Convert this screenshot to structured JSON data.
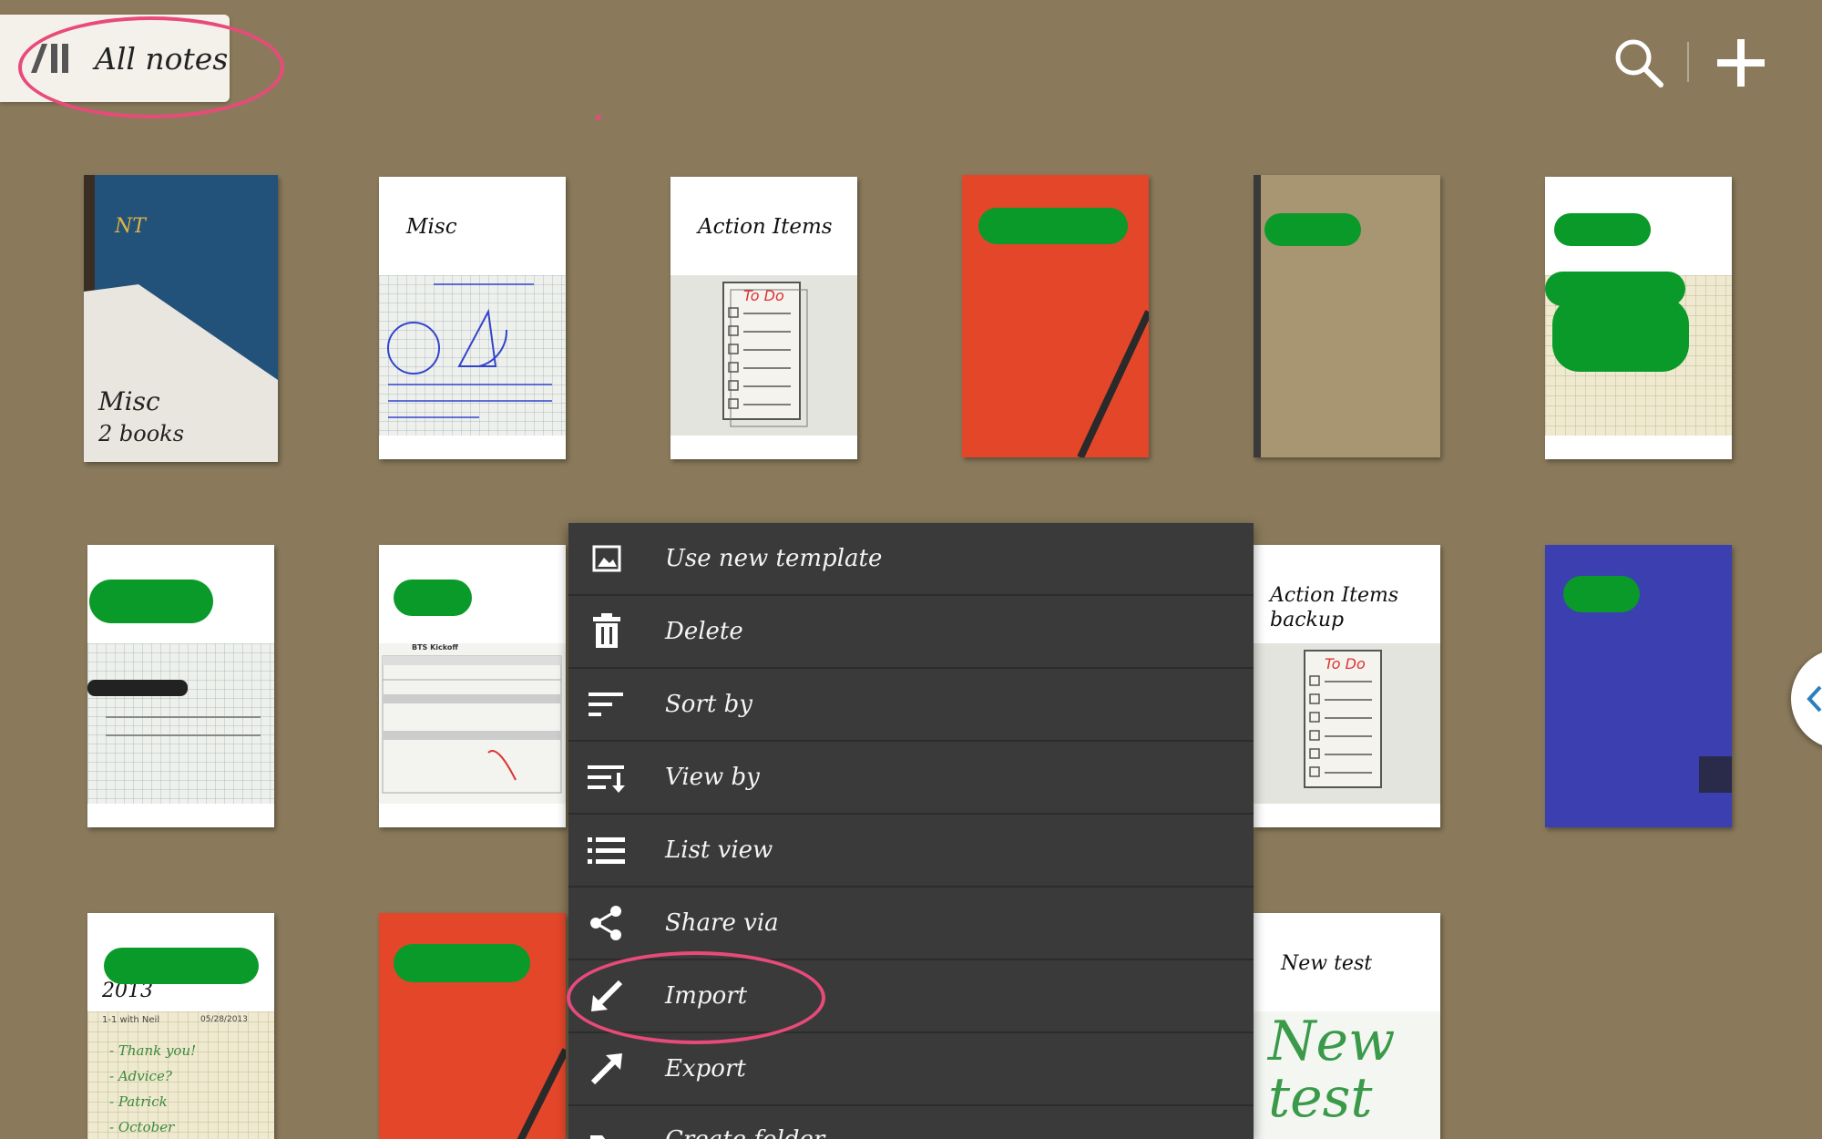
{
  "header": {
    "title": "All notes",
    "search_icon": "search-icon",
    "add_icon": "plus-icon"
  },
  "notebooks": [
    {
      "id": "misc-folder",
      "cover_label": "NT",
      "title": "Misc",
      "subtitle": "2 books"
    },
    {
      "id": "misc",
      "title": "Misc"
    },
    {
      "id": "action-items",
      "title": "Action Items",
      "page_text": "To Do"
    },
    {
      "id": "red-book",
      "title": ""
    },
    {
      "id": "kraft-book",
      "title": ""
    },
    {
      "id": "yellow-book",
      "title": ""
    },
    {
      "id": "grid-note",
      "title": ""
    },
    {
      "id": "table-note",
      "title": "",
      "page_text": "BTS Kickoff"
    },
    {
      "id": "action-items-backup",
      "title": "Action Items backup",
      "page_text": "To Do"
    },
    {
      "id": "blue-book",
      "title": ""
    },
    {
      "id": "note-2013",
      "title": "2013",
      "page_header": "1-1 with Neil",
      "page_date": "05/28/2013",
      "page_lines": [
        "- Thank you!",
        "- Advice?",
        "- Patrick",
        "- October"
      ]
    },
    {
      "id": "red-book-2",
      "title": ""
    },
    {
      "id": "new-test",
      "title": "New test",
      "page_text": "New test"
    }
  ],
  "menu": {
    "items": [
      {
        "label": "Use new template",
        "icon": "template-icon"
      },
      {
        "label": "Delete",
        "icon": "trash-icon"
      },
      {
        "label": "Sort by",
        "icon": "sort-icon"
      },
      {
        "label": "View by",
        "icon": "view-by-icon"
      },
      {
        "label": "List view",
        "icon": "list-icon"
      },
      {
        "label": "Share via",
        "icon": "share-icon"
      },
      {
        "label": "Import",
        "icon": "import-icon"
      },
      {
        "label": "Export",
        "icon": "export-icon"
      },
      {
        "label": "Create folder",
        "icon": "folder-icon"
      }
    ]
  },
  "colors": {
    "background": "#8a7a5b",
    "menu_bg": "#3a3a3a",
    "annotation": "#e84a7a",
    "redaction": "#0a9a2a"
  }
}
